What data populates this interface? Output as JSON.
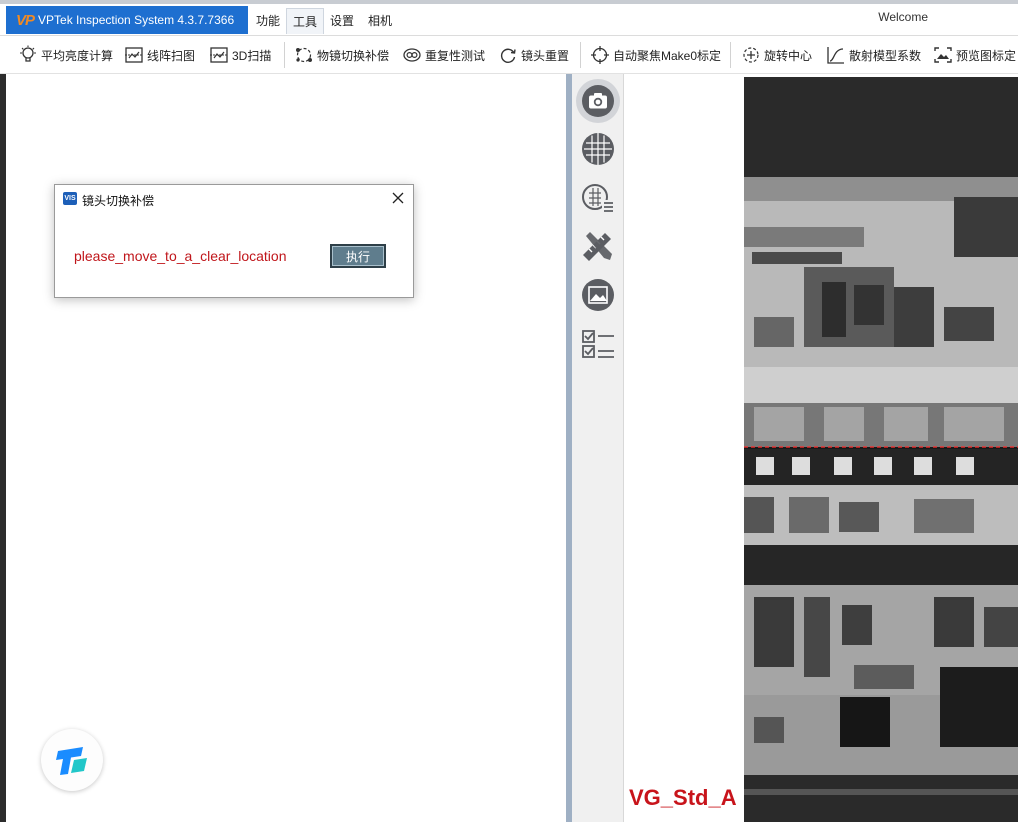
{
  "app": {
    "title": "VPTek Inspection System 4.3.7.7366",
    "logo_text": "VP",
    "welcome": "Welcome"
  },
  "menu": {
    "tabs": [
      "功能",
      "工具",
      "设置",
      "相机"
    ],
    "active": "工具"
  },
  "toolbar": {
    "items": [
      {
        "label": "平均亮度计算",
        "icon": "bulb-icon"
      },
      {
        "label": "线阵扫图",
        "icon": "line-scan-icon"
      },
      {
        "label": "3D扫描",
        "icon": "scan-3d-icon"
      },
      {
        "label": "物镜切换补偿",
        "icon": "lens-switch-icon"
      },
      {
        "label": "重复性测试",
        "icon": "repeat-test-icon"
      },
      {
        "label": "镜头重置",
        "icon": "reset-icon"
      },
      {
        "label": "自动聚焦Make0标定",
        "icon": "crosshair-icon"
      },
      {
        "label": "旋转中心",
        "icon": "rotation-center-icon"
      },
      {
        "label": "散射模型系数",
        "icon": "curve-icon"
      },
      {
        "label": "预览图标定",
        "icon": "preview-calibrate-icon"
      }
    ]
  },
  "dialog": {
    "icon_text": "VIS",
    "title": "镜头切换补偿",
    "message": "please_move_to_a_clear_location",
    "execute_label": "执行"
  },
  "sidebar": {
    "buttons": [
      {
        "icon": "camera-icon",
        "active": true
      },
      {
        "icon": "grid-sphere-icon",
        "active": false
      },
      {
        "icon": "grid-list-icon",
        "active": false
      },
      {
        "icon": "ruler-pencil-icon",
        "active": false
      },
      {
        "icon": "image-frame-icon",
        "active": false
      },
      {
        "icon": "checklist-icon",
        "active": false
      }
    ]
  },
  "viewer": {
    "label": "VG_Std_A",
    "crosshair_color": "#ff2a2a"
  },
  "colors": {
    "brand": "#1e6fd0",
    "dialog_message": "#c0161b",
    "execute_button": "#5f7d8d",
    "viewer_label": "#c8141b"
  }
}
